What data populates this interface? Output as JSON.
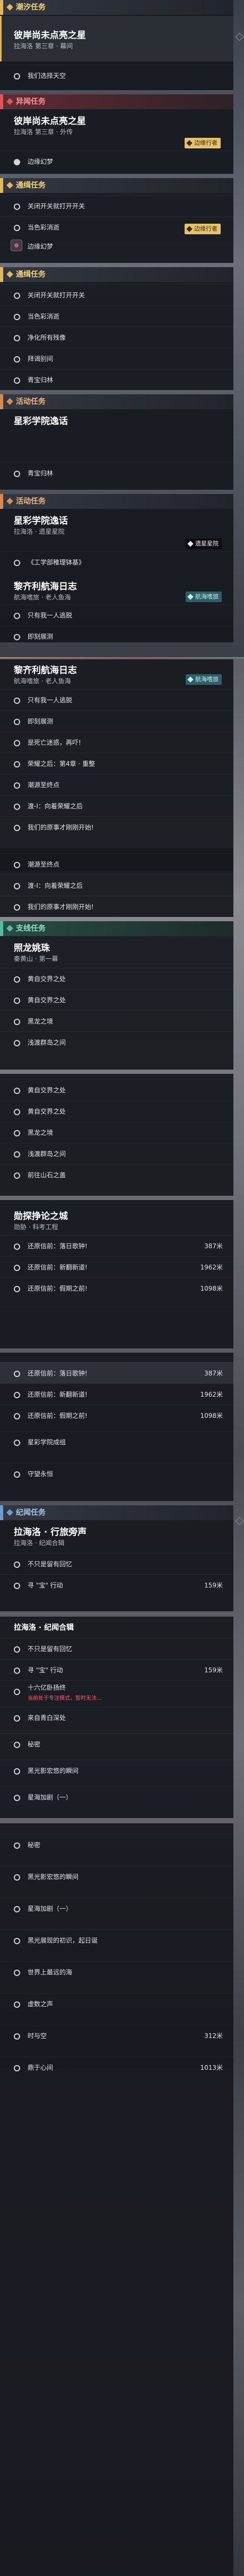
{
  "sections": {
    "chaoxi_header": "潮汐任务",
    "chaoxi_title": "彼岸尚未点亮之星",
    "chaoxi_sub": "拉海洛 第三章 · 幕间",
    "chaoxi_obj": "我们选择天空",
    "yiwen_header": "异闻任务",
    "yiwen_title": "彼岸尚未点亮之星",
    "yiwen_sub": "拉海洛 第三章 · 外传",
    "yiwen_tag": "边缘行者",
    "yiwen_obj": "边缘幻梦",
    "tongji1_header": "通缉任务",
    "tongji1_obj1": "关闭开关就打开开关",
    "tongji1_obj2": "当色彩消逝",
    "tongji1_tag": "边缘行者",
    "tongji1_obj3": "边缘幻梦",
    "tongji2_header": "通缉任务",
    "tongji2_objs": [
      "关闭开关就打开开关",
      "当色彩消逝",
      "净化所有残像",
      "拜谒别间",
      "青宝归林"
    ],
    "huodong_header": "活动任务",
    "huodong_title": "星彩学院逸话",
    "huodong_obj": "青宝归林",
    "huodong2_header": "活动任务",
    "huodong2_title": "星彩学院逸话",
    "huodong2_sub": "拉海洛 · 遗星星院",
    "huodong2_tag": "遗星星院",
    "huodong2_obj": "《工学部稚理钵基》",
    "liming_title": "黎齐利航海日志",
    "liming_sub": "航海嗜旅 · 老人鱼海",
    "liming_tag": "航海嗜旅",
    "liming_objs": [
      "只有我一人逃脱",
      "即刻展测",
      "是死亡迷惑，再吓!"
    ],
    "liming2_title": "黎齐利航海日志",
    "liming2_sub": "航海嗜旅 · 老人鱼海",
    "liming2_tag": "航海嗜旅",
    "liming2_objs": [
      "只有我一人逃脱",
      "即刻展测",
      "是死亡迷惑，再吓!",
      "荣耀之后：第4章 · 重整",
      "潮源至终点",
      "渡-Ⅰ：向着荣耀之后",
      "我们的原事才刚刚开始!"
    ],
    "liming3_objs": [
      "潮源至终点",
      "渡-Ⅰ：向着荣耀之后",
      "我们的原事才刚刚开始!"
    ],
    "zhongxing_header": "支线任务",
    "zhongxing_title": "照龙姚珠",
    "zhongxing_sub": "秦黄山 · 第一幕",
    "zhongxing_objs": [
      "黄自交界之处",
      "黄自交界之处",
      "黑龙之境",
      "浅渡群岛之间"
    ],
    "zhongxing2_objs": [
      "黄自交界之处",
      "黄自交界之处",
      "黑龙之境",
      "浅渡群岛之间",
      "前往山石之盖"
    ],
    "yuanzheng_title": "勋探挣论之城",
    "yuanzheng_sub": "勋胁 · 科考工程",
    "yuanzheng_objs": [
      {
        "t": "还原信前：落日歌钟!",
        "d": "387米"
      },
      {
        "t": "还原信前：新翻新道!",
        "d": "1962米"
      },
      {
        "t": "还原信前：假期之前!",
        "d": "1098米"
      }
    ],
    "yuanzheng2_objs": [
      {
        "t": "还原信前：落日歌钟!",
        "d": "387米"
      },
      {
        "t": "还原信前：新翻新道!",
        "d": "1962米"
      },
      {
        "t": "还原信前：假期之前!",
        "d": "1098米"
      }
    ],
    "yuanzheng_extra": [
      "星彩学院成组",
      "守望永恒"
    ],
    "jiyuan_header": "纪闻任务",
    "jiyuan_title": "拉海洛 · 行旅旁声",
    "jiyuan_sub": "拉海洛 · 纪闻合辑",
    "jiyuan_objs": [
      {
        "t": "不只是留有回忆",
        "d": ""
      },
      {
        "t": "寻 \"宝\" 行动",
        "d": "159米"
      }
    ],
    "jiyuan2_title": "拉海洛 · 纪闻合辑",
    "jiyuan2_objs": [
      {
        "t": "不只是留有回忆",
        "d": ""
      },
      {
        "t": "寻 \"宝\" 行动",
        "d": "159米"
      },
      {
        "t": "十六亿卧扬终",
        "d": ""
      },
      {
        "t": "来自青白深处",
        "d": ""
      },
      {
        "t": "秘密",
        "d": ""
      },
      {
        "t": "黑光影宏悠的瞬间",
        "d": ""
      },
      {
        "t": "星海加剧（一）",
        "d": ""
      }
    ],
    "jiyuan2_warn": "当前处于专注模式，暂时无法...",
    "final_objs": [
      {
        "t": "秘密",
        "d": ""
      },
      {
        "t": "黑光影宏悠的瞬间",
        "d": ""
      },
      {
        "t": "星海加剧（一）",
        "d": ""
      },
      {
        "t": "黑光展现的初识，起日诞",
        "d": ""
      },
      {
        "t": "世界上最远的海",
        "d": ""
      },
      {
        "t": "虚数之声",
        "d": ""
      },
      {
        "t": "时与空",
        "d": "312米"
      },
      {
        "t": "鼎于心间",
        "d": "1013米"
      }
    ]
  }
}
